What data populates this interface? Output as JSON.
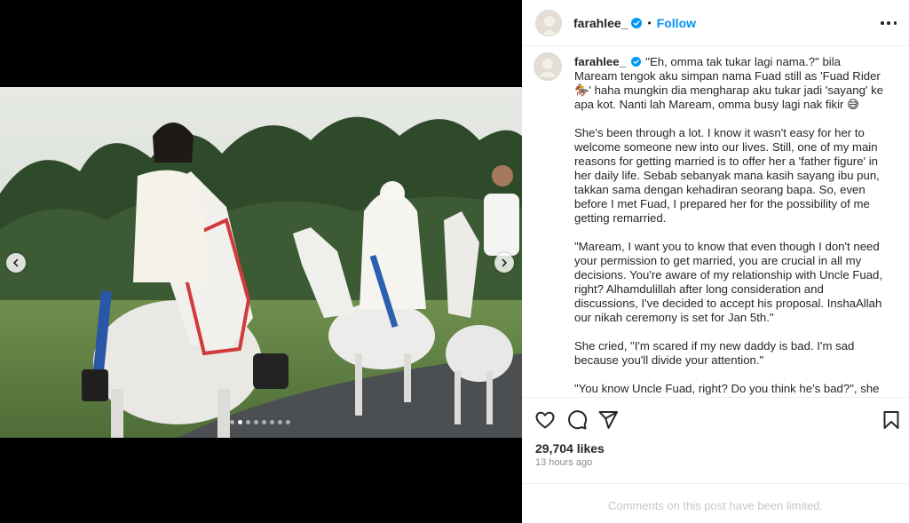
{
  "post": {
    "username": "farahlee_",
    "verified": true,
    "separator": "•",
    "follow_label": "Follow",
    "more_icon": "more-horizontal-icon"
  },
  "media": {
    "description_icon": "photo",
    "carousel": {
      "total": 8,
      "current": 2
    },
    "prev_icon": "chevron-left-icon",
    "next_icon": "chevron-right-icon"
  },
  "caption": {
    "username": "farahlee_",
    "paragraphs": [
      "\"Eh, omma tak tukar lagi nama.?\" bila Maream tengok aku simpan nama Fuad still as 'Fuad Rider 🏇' haha mungkin dia mengharap aku tukar jadi 'sayang' ke apa kot. Nanti lah Maream, omma busy lagi nak fikir 😅",
      "She's been through a lot. I know it wasn't easy for her to welcome someone new into our lives. Still, one of my main reasons for getting married is to offer her a 'father figure' in her daily life. Sebab sebanyak mana kasih sayang ibu pun, takkan sama dengan kehadiran seorang bapa. So, even before I met Fuad, I prepared her for the possibility of me getting remarried.",
      "\"Maream, I want you to know that even though I don't need your permission to get married, you are crucial in all my decisions. You're aware of my relationship with Uncle Fuad, right? Alhamdulillah after long consideration and discussions, I've decided to accept his proposal. InshaAllah our nikah ceremony is set for Jan 5th.\"",
      "She cried, \"I'm scared if my new daddy is bad. I'm sad because you'll divide your attention.\"",
      "\"You know Uncle Fuad, right? Do you think he's bad?\", she shook her head."
    ]
  },
  "actions": {
    "like_icon": "heart-icon",
    "comment_icon": "comment-icon",
    "share_icon": "send-icon",
    "save_icon": "bookmark-icon",
    "likes": "29,704 likes",
    "time": "13 hours ago",
    "comments_limited": "Comments on this post have been limited."
  },
  "colors": {
    "accent": "#0095f6",
    "text": "#262626",
    "muted": "#8e8e8e",
    "border": "#efefef"
  }
}
